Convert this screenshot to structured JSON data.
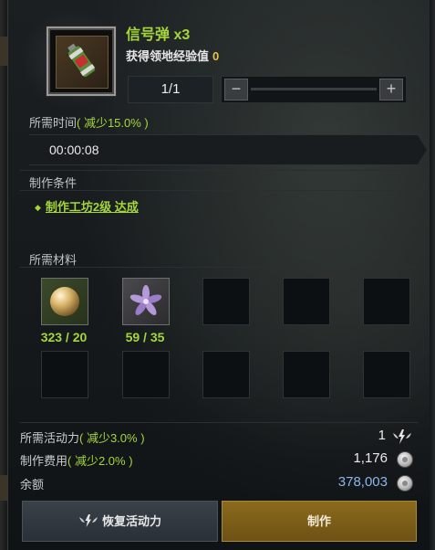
{
  "item": {
    "title": "信号弹 x3",
    "exp_label": "获得领地经验值",
    "exp_value": "0",
    "icon": "flare-canister-icon"
  },
  "quantity": {
    "value": "1/1",
    "minus_label": "−",
    "plus_label": "+"
  },
  "time": {
    "label": "所需时间",
    "reduction": "( 减少15.0% )",
    "value": "00:00:08"
  },
  "conditions": {
    "label": "制作条件",
    "items": [
      {
        "text": "制作工坊2级 达成"
      }
    ]
  },
  "materials": {
    "label": "所需材料",
    "slots": [
      {
        "icon": "pearl-orb-icon",
        "count": "323 / 20",
        "filled": true
      },
      {
        "icon": "purple-flower-icon",
        "count": "59 / 35",
        "filled": true
      },
      {
        "filled": false
      },
      {
        "filled": false
      },
      {
        "filled": false
      },
      {
        "filled": false
      },
      {
        "filled": false
      },
      {
        "filled": false
      },
      {
        "filled": false
      },
      {
        "filled": false
      }
    ]
  },
  "costs": {
    "energy_label": "所需活动力",
    "energy_reduction": "( 减少3.0% )",
    "energy_value": "1",
    "fee_label": "制作费用",
    "fee_reduction": "( 减少2.0% )",
    "fee_value": "1,176",
    "balance_label": "余额",
    "balance_value": "378,003"
  },
  "buttons": {
    "restore": "恢复活动力",
    "make": "制作"
  },
  "colors": {
    "accent_green": "#a4d63a",
    "exp_yellow": "#e8c24a",
    "balance_blue": "#8fb4e8",
    "make_button": "#8a6a1c"
  }
}
